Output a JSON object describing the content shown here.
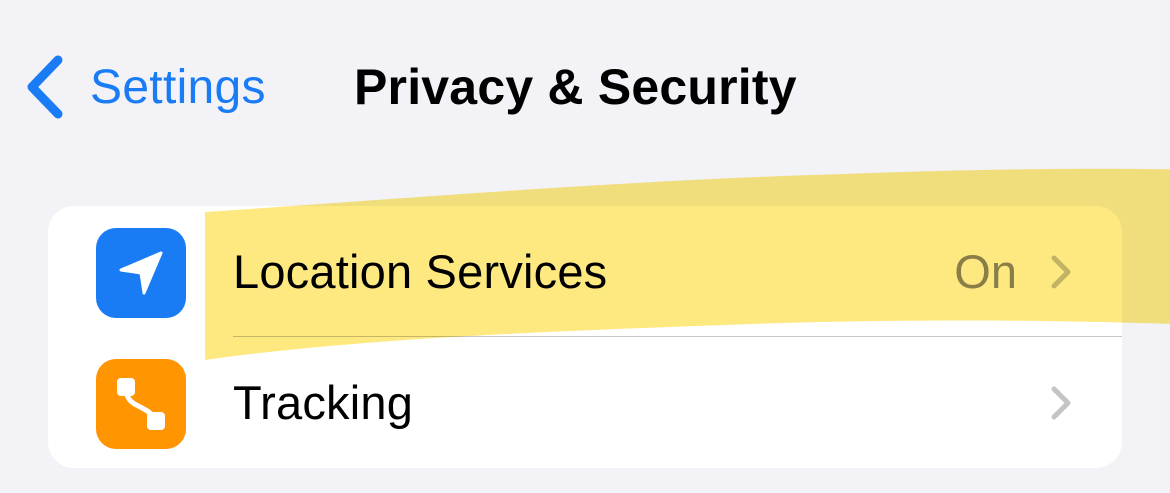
{
  "nav": {
    "back_label": "Settings",
    "title": "Privacy & Security"
  },
  "rows": [
    {
      "label": "Location Services",
      "value": "On",
      "icon": "location-arrow-icon",
      "icon_color": "#1a7cf5"
    },
    {
      "label": "Tracking",
      "value": "",
      "icon": "tracking-icon",
      "icon_color": "#ff9500"
    }
  ],
  "colors": {
    "accent": "#1a7cf5",
    "background": "#f2f2f7",
    "highlight": "#fde56a"
  }
}
